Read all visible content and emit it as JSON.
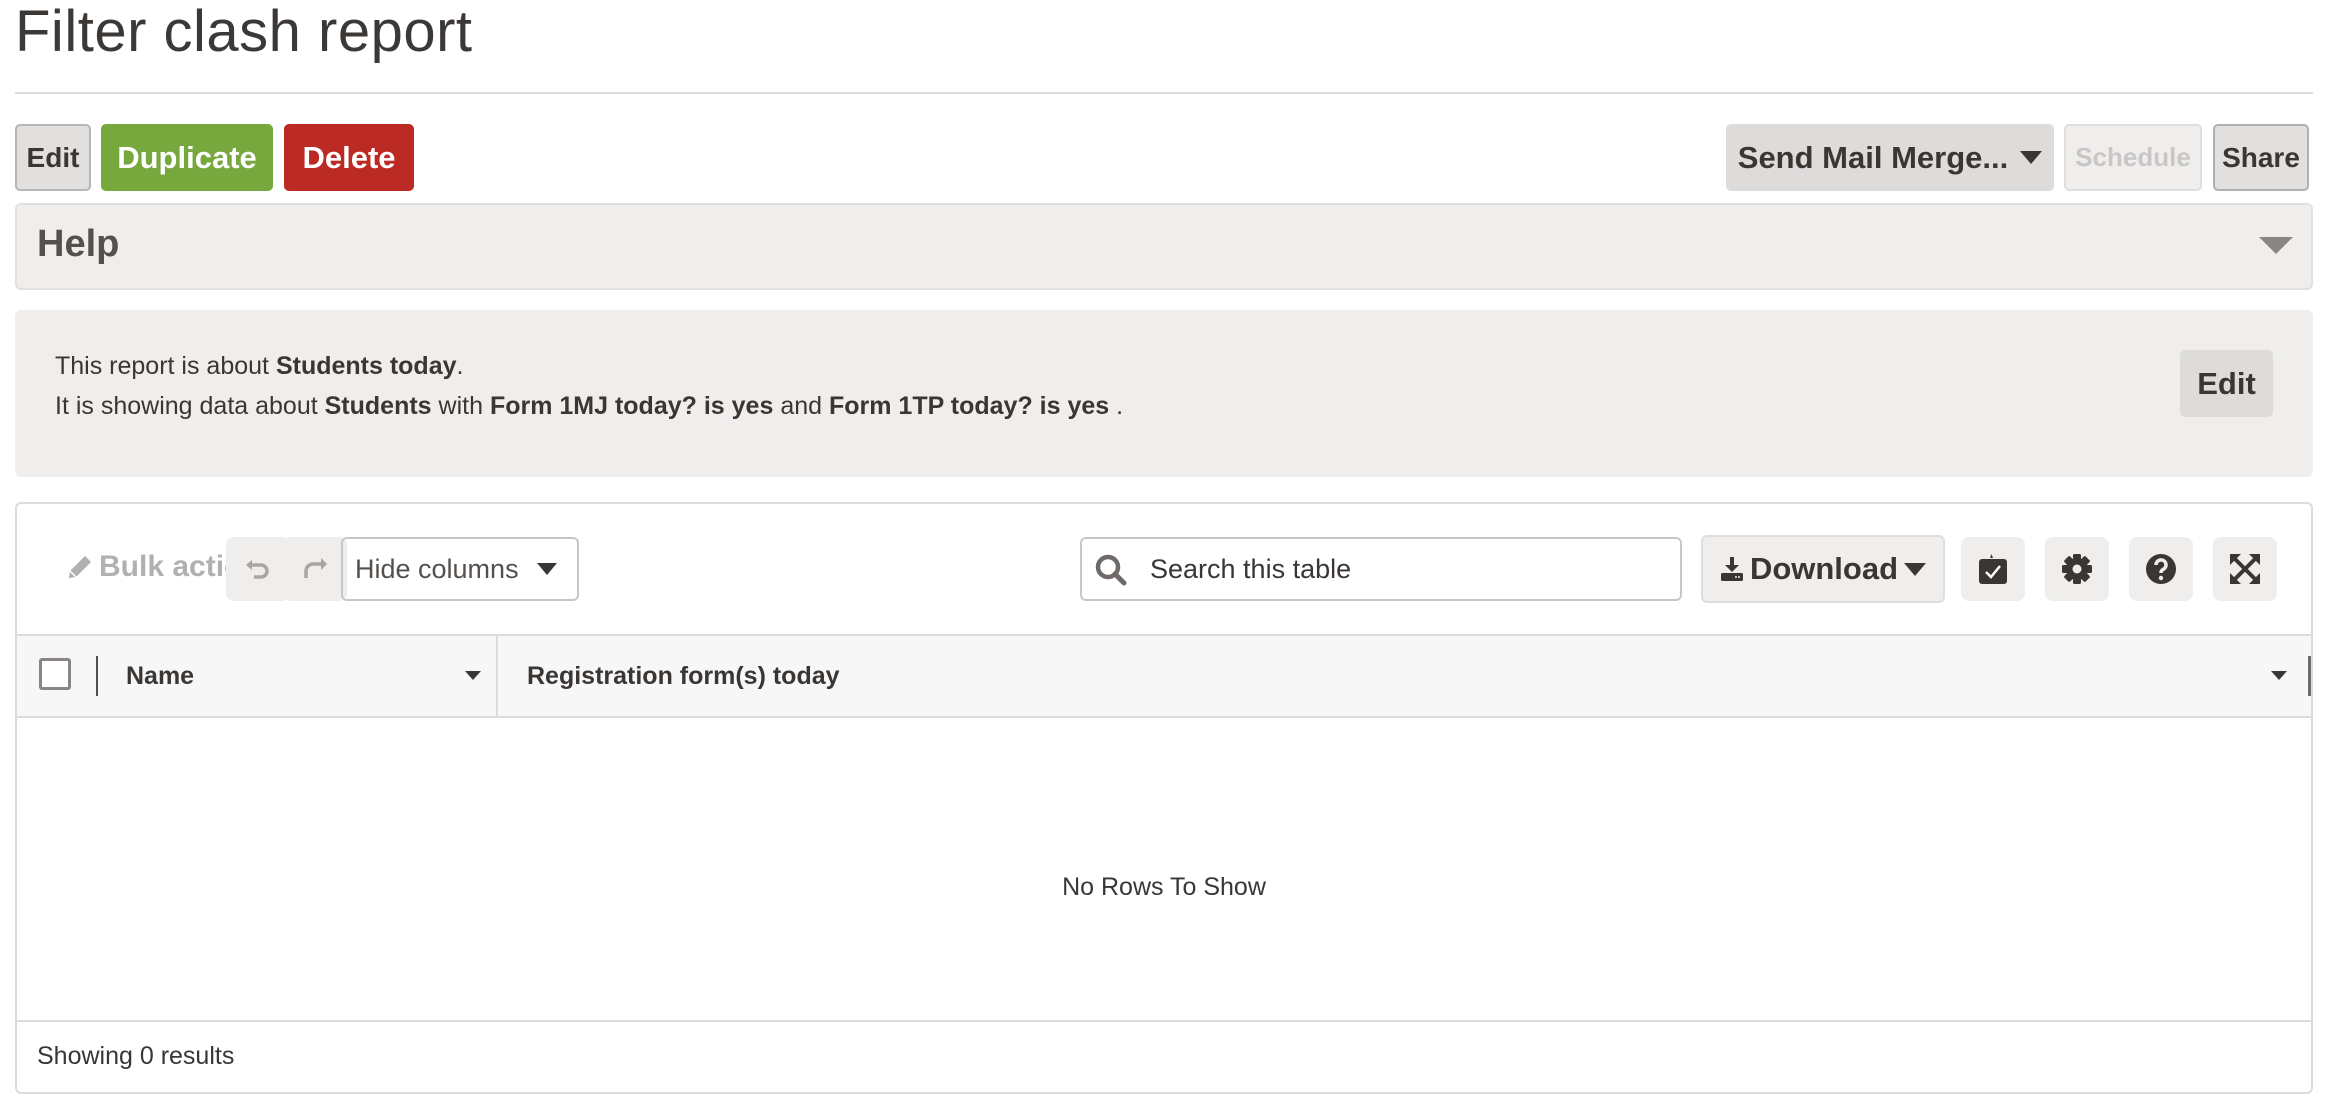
{
  "page": {
    "title": "Filter clash report"
  },
  "actions": {
    "edit_label": "Edit",
    "duplicate_label": "Duplicate",
    "delete_label": "Delete",
    "mail_merge_label": "Send Mail Merge...",
    "schedule_label": "Schedule",
    "share_label": "Share"
  },
  "help": {
    "title": "Help"
  },
  "info": {
    "line1_prefix": "This report is about ",
    "line1_subject": "Students today",
    "line1_suffix": ".",
    "line2_prefix": "It is showing data about ",
    "line2_entity": "Students",
    "line2_with": " with ",
    "line2_cond1": "Form 1MJ today? is yes",
    "line2_and": " and ",
    "line2_cond2": "Form 1TP today? is yes",
    "line2_suffix": " .",
    "edit_label": "Edit"
  },
  "toolbar": {
    "bulk_action_label": "Bulk action",
    "hide_columns_label": "Hide columns",
    "search_placeholder": "Search this table",
    "search_value": "",
    "download_label": "Download"
  },
  "icons": {
    "pencil": "pencil-icon",
    "undo": "undo-icon",
    "redo": "redo-icon",
    "search": "search-icon",
    "download": "download-icon",
    "bulk_edit": "calendar-check-icon",
    "settings": "gear-icon",
    "help": "question-circle-icon",
    "fullscreen": "expand-arrows-icon"
  },
  "table": {
    "columns": [
      {
        "label": "Name"
      },
      {
        "label": "Registration form(s) today"
      }
    ],
    "rows": [],
    "empty_message": "No Rows To Show",
    "results_text": "Showing 0 results"
  },
  "colors": {
    "success": "#77a83d",
    "danger": "#bb2b24",
    "panel_bg": "#efeeed",
    "text": "#3a3634"
  }
}
